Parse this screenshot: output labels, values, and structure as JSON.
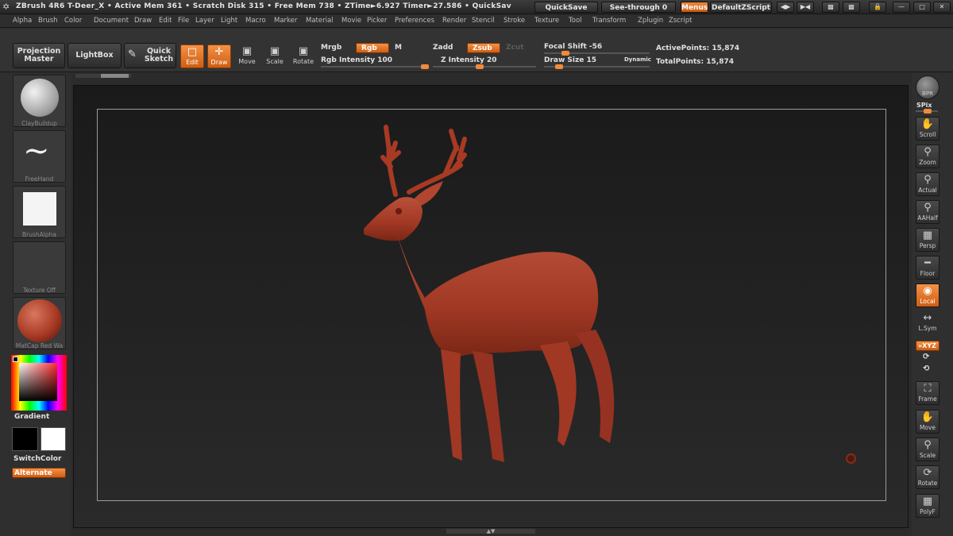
{
  "titlebar": {
    "status_text": "ZBrush 4R6   T-Deer_X  • Active Mem 361 • Scratch Disk 315 • Free Mem 738 • ZTime►6.927  Timer►27.586 • QuickSav",
    "quicksave": "QuickSave",
    "seethrough": "See-through   0",
    "menus": "Menus",
    "script": "DefaultZScript"
  },
  "menubar": [
    "Alpha",
    "Brush",
    "Color",
    "Document",
    "Draw",
    "Edit",
    "File",
    "Layer",
    "Light",
    "Macro",
    "Marker",
    "Material",
    "Movie",
    "Picker",
    "Preferences",
    "Render",
    "Stencil",
    "Stroke",
    "Texture",
    "Tool",
    "Transform",
    "Zplugin",
    "Zscript"
  ],
  "toolbar": {
    "projection_master": "Projection Master",
    "lightbox": "LightBox",
    "quick_sketch": "Quick Sketch",
    "edit": "Edit",
    "draw": "Draw",
    "move": "Move",
    "scale": "Scale",
    "rotate": "Rotate",
    "mrgb": "Mrgb",
    "rgb": "Rgb",
    "m": "M",
    "rgb_intensity": "Rgb  Intensity 100",
    "zadd": "Zadd",
    "zsub": "Zsub",
    "zcut": "Zcut",
    "z_intensity": "Z Intensity 20",
    "focal_shift": "Focal Shift -56",
    "draw_size": "Draw Size 15",
    "dynamic": "Dynamic",
    "active_points": "ActivePoints: 15,874",
    "total_points": "TotalPoints: 15,874",
    "rgb_intensity_value": 100,
    "z_intensity_value": 20
  },
  "leftshelf": {
    "brush": "ClayBuildup",
    "stroke": "FreeHand",
    "alpha": "BrushAlpha",
    "texture": "Texture Off",
    "material": "MatCap Red Wa",
    "gradient": "Gradient",
    "switchcolor": "SwitchColor",
    "alternate": "Alternate"
  },
  "rightshelf": {
    "bpr": "BPR",
    "spix": "SPix",
    "scroll": "Scroll",
    "zoom": "Zoom",
    "actual": "Actual",
    "aahalf": "AAHalf",
    "persp": "Persp",
    "floor": "Floor",
    "local": "Local",
    "lsym": "L.Sym",
    "xyz": "»XYZ",
    "frame": "Frame",
    "move": "Move",
    "scale": "Scale",
    "rotate": "Rotate",
    "polyf": "PolyF"
  },
  "colors": {
    "accent": "#e8762a",
    "model": "#a83a24",
    "primary_color": "#000000",
    "secondary_color": "#ffffff"
  }
}
